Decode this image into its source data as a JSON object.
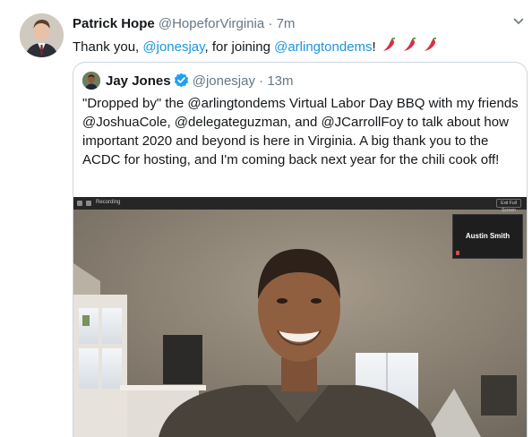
{
  "tweet": {
    "author_name": "Patrick Hope",
    "author_handle": "@HopeforVirginia",
    "separator": "·",
    "time": "7m",
    "text_parts": {
      "t1": "Thank you, ",
      "m1": "@jonesjay",
      "t2": ", for joining ",
      "m2": "@arlingtondems",
      "t3": "!"
    },
    "emoji": [
      "hot-pepper",
      "hot-pepper",
      "hot-pepper"
    ]
  },
  "quoted": {
    "author_name": "Jay Jones",
    "author_handle": "@jonesjay",
    "separator": "·",
    "time": "13m",
    "verified": true,
    "text": "\"Dropped by\" the @arlingtondems Virtual Labor Day BBQ with my friends @JoshuaCole, @delegateguzman, and @JCarrollFoy to talk about how important 2020 and beyond is here in Virginia. A big thank you to the ACDC for hosting, and I'm coming back next year for the chili cook off!"
  },
  "media": {
    "zoom_bar": {
      "recording_label": "Recording",
      "exit_label": "Exit Full Screen"
    },
    "participant_tile_name": "Austin Smith"
  },
  "colors": {
    "link": "#1b95e0",
    "muted": "#657786",
    "verified": "#1da1f2",
    "border": "#ccd6dd"
  }
}
